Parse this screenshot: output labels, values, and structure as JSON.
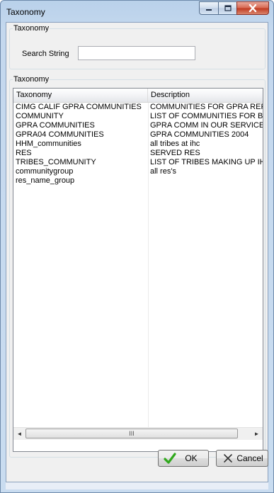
{
  "window": {
    "title": "Taxonomy",
    "minimize_glyph": "–",
    "maximize_glyph": "□",
    "close_glyph": "X"
  },
  "search_group": {
    "legend": "Taxonomy",
    "search_label": "Search String",
    "search_value": "",
    "search_placeholder": ""
  },
  "list_group": {
    "legend": "Taxonomy",
    "columns": [
      "Taxonomy",
      "Description"
    ],
    "rows": [
      {
        "taxonomy": "CIMG CALIF GPRA COMMUNITIES",
        "description": "COMMUNITIES FOR GPRA REF"
      },
      {
        "taxonomy": "COMMUNITY",
        "description": "LIST OF COMMUNITIES FOR B("
      },
      {
        "taxonomy": "GPRA COMMUNITIES",
        "description": "GPRA COMM IN OUR SERVICE"
      },
      {
        "taxonomy": "GPRA04 COMMUNITIES",
        "description": "GPRA COMMUNITIES 2004"
      },
      {
        "taxonomy": "HHM_communities",
        "description": "all tribes at ihc"
      },
      {
        "taxonomy": "RES",
        "description": "SERVED RES"
      },
      {
        "taxonomy": "TRIBES_COMMUNITY",
        "description": "LIST OF TRIBES MAKING UP IH"
      },
      {
        "taxonomy": "communitygroup",
        "description": "all res's"
      },
      {
        "taxonomy": "res_name_group",
        "description": ""
      },
      {
        "taxonomy": "",
        "description": ""
      },
      {
        "taxonomy": "",
        "description": ""
      },
      {
        "taxonomy": "",
        "description": ""
      },
      {
        "taxonomy": "",
        "description": ""
      },
      {
        "taxonomy": "",
        "description": ""
      },
      {
        "taxonomy": "",
        "description": ""
      },
      {
        "taxonomy": "",
        "description": ""
      },
      {
        "taxonomy": "",
        "description": ""
      },
      {
        "taxonomy": "",
        "description": ""
      },
      {
        "taxonomy": "",
        "description": ""
      },
      {
        "taxonomy": "",
        "description": ""
      },
      {
        "taxonomy": "",
        "description": ""
      },
      {
        "taxonomy": "",
        "description": ""
      },
      {
        "taxonomy": "",
        "description": ""
      },
      {
        "taxonomy": "",
        "description": ""
      },
      {
        "taxonomy": "",
        "description": ""
      },
      {
        "taxonomy": "",
        "description": ""
      },
      {
        "taxonomy": "",
        "description": ""
      },
      {
        "taxonomy": "",
        "description": ""
      },
      {
        "taxonomy": "",
        "description": ""
      },
      {
        "taxonomy": "",
        "description": ""
      },
      {
        "taxonomy": "",
        "description": ""
      },
      {
        "taxonomy": "",
        "description": ""
      },
      {
        "taxonomy": "",
        "description": ""
      },
      {
        "taxonomy": "",
        "description": ""
      },
      {
        "taxonomy": "",
        "description": ""
      }
    ],
    "scrollbar": {
      "left_arrow": "◄",
      "right_arrow": "►",
      "grip": "III"
    }
  },
  "buttons": {
    "ok_label": "OK",
    "ok_icon": "checkmark-icon",
    "cancel_label": "Cancel",
    "cancel_icon": "x-icon"
  },
  "colors": {
    "ok_check": "#2fa81c",
    "close_button": "#c8432b"
  }
}
